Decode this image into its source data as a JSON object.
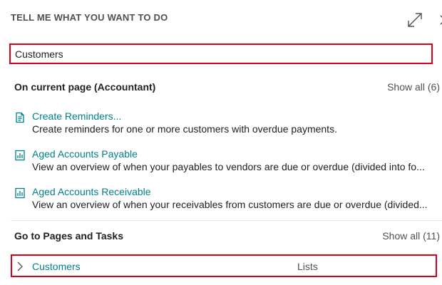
{
  "header": {
    "title": "TELL ME WHAT YOU WANT TO DO",
    "expand_icon": "expand-icon",
    "close_icon": "close-icon"
  },
  "search": {
    "value": "Customers"
  },
  "current_page": {
    "title": "On current page (Accountant)",
    "show_all": "Show all (6)",
    "results": [
      {
        "icon": "document-icon",
        "label": "Create Reminders...",
        "description": "Create reminders for one or more customers with overdue payments."
      },
      {
        "icon": "report-icon",
        "label": "Aged Accounts Payable",
        "description": "View an overview of when your payables to vendors are due or overdue (divided into fo..."
      },
      {
        "icon": "report-icon",
        "label": "Aged Accounts Receivable",
        "description": "View an overview of when your receivables from customers are due or overdue (divided..."
      }
    ]
  },
  "pages_and_tasks": {
    "title": "Go to Pages and Tasks",
    "show_all": "Show all (11)",
    "items": [
      {
        "icon": "chevron-right-icon",
        "label": "Customers",
        "type": "Lists"
      }
    ]
  },
  "colors": {
    "accent": "#00808a",
    "highlight_border": "#d9001b",
    "muted_text": "#505050"
  }
}
